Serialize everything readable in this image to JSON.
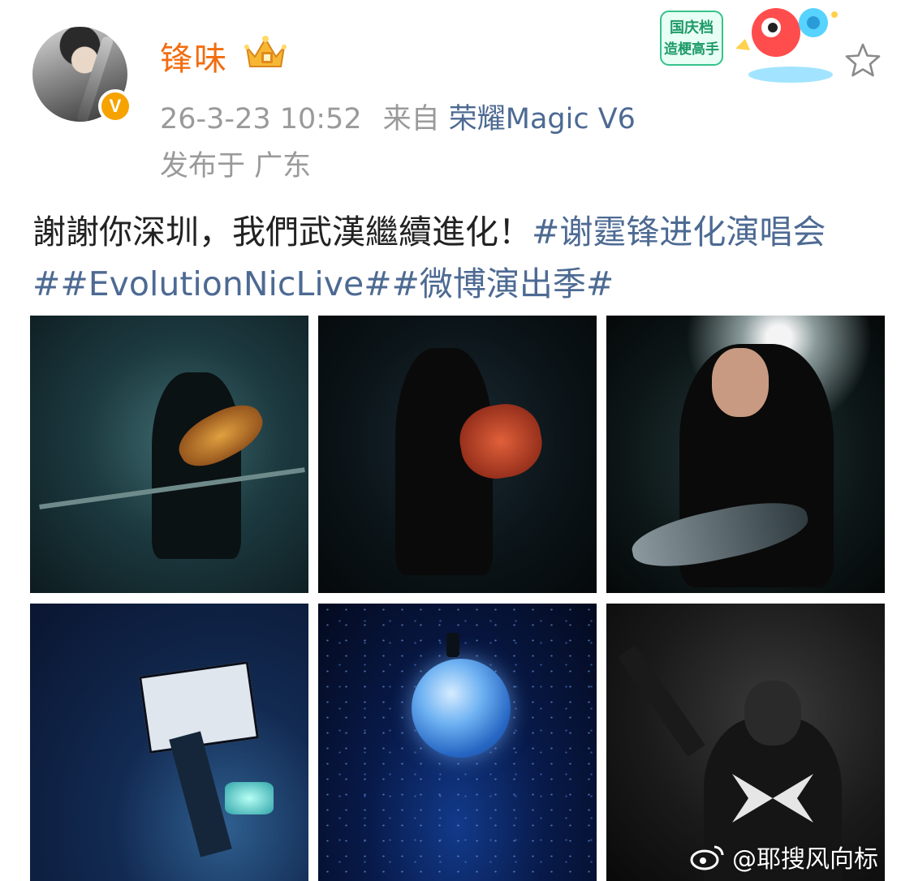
{
  "post": {
    "author": {
      "name": "锋味",
      "verified_mark": "V"
    },
    "timestamp": "26-3-23 10:52",
    "source_prefix": "来自",
    "device": "荣耀Magic V6",
    "location_label": "发布于 广东",
    "text": {
      "body": "謝謝你深圳，我們武漢繼續進化！",
      "tags": "#谢霆锋进化演唱会##EvolutionNicLive##微博演出季#"
    },
    "badge": {
      "text_line1": "国庆档",
      "text_line2": "造梗高手"
    },
    "images": [
      {
        "icon": "concert-photo-guitar-railing"
      },
      {
        "icon": "concert-photo-jump-guitar"
      },
      {
        "icon": "concert-photo-guitar-spotlight"
      },
      {
        "icon": "concert-photo-stage-rig"
      },
      {
        "icon": "concert-photo-globe"
      },
      {
        "icon": "concert-photo-back-raised-arm"
      }
    ]
  },
  "watermark": {
    "text": "@耶搜风向标"
  },
  "colors": {
    "username": "#f26d0f",
    "link": "#4d6a93",
    "meta": "#9a9a9a",
    "verified": "#f6a300"
  }
}
